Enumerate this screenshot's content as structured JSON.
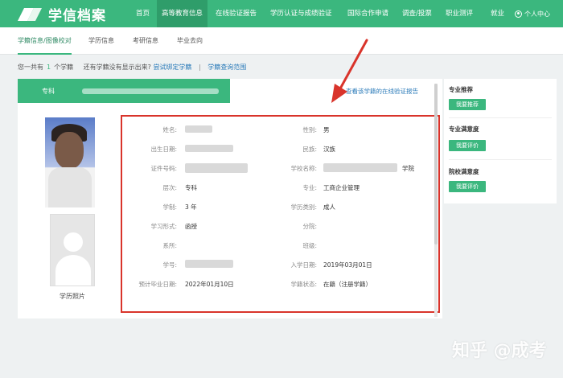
{
  "app": {
    "logo_text": "学信档案"
  },
  "topnav": {
    "items": [
      "首页",
      "高等教育信息",
      "在线验证报告",
      "学历认证与成绩验证",
      "国际合作申请",
      "调查/投票",
      "职业测评",
      "就业"
    ],
    "user": "个人中心",
    "active_index": 1
  },
  "subnav": {
    "items": [
      "学籍信息/图像校对",
      "学历信息",
      "考研信息",
      "毕业去向"
    ],
    "active_index": 0
  },
  "infoline": {
    "prefix": "您一共有",
    "count": "1",
    "suffix": "个学籍",
    "question": "还有学籍没有显示出来?",
    "link1": "尝试绑定学籍",
    "sep": "|",
    "link2": "学籍查询范围"
  },
  "record": {
    "header_prefix": "专科",
    "verify_link": "查看该学籍的在线验证报告",
    "photo_caption": "学历照片",
    "fields": {
      "name_label": "姓名:",
      "gender_label": "性别:",
      "gender": "男",
      "birth_label": "出生日期:",
      "ethnicity_label": "民族:",
      "ethnicity": "汉族",
      "id_label": "证件号码:",
      "school_label": "学校名称:",
      "school_suffix": "学院",
      "level_label": "层次:",
      "level": "专科",
      "major_label": "专业:",
      "major": "工商企业管理",
      "duration_label": "学制:",
      "duration": "3 年",
      "edu_type_label": "学历类别:",
      "edu_type": "成人",
      "study_form_label": "学习形式:",
      "study_form": "函授",
      "branch_label": "分院:",
      "dept_label": "系所:",
      "class_label": "班级:",
      "student_no_label": "学号:",
      "enroll_label": "入学日期:",
      "enroll": "2019年03月01日",
      "grad_label": "预计毕业日期:",
      "grad": "2022年01月10日",
      "status_label": "学籍状态:",
      "status": "在籍（注册学籍）"
    }
  },
  "sidebar": {
    "sections": [
      {
        "title": "专业推荐",
        "button": "我要推荐"
      },
      {
        "title": "专业满意度",
        "button": "我要评价"
      },
      {
        "title": "院校满意度",
        "button": "我要评价"
      }
    ]
  },
  "watermark": "知乎 @成考",
  "colors": {
    "brand": "#3bb77e",
    "highlight": "#d9342b",
    "link": "#2b7bb9"
  }
}
